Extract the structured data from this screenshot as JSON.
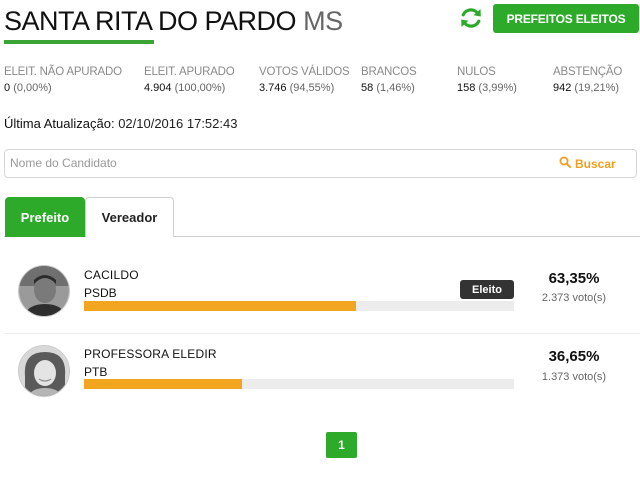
{
  "header": {
    "city": "SANTA RITA DO PARDO",
    "uf": "MS",
    "eleitos_button": "PREFEITOS ELEITOS",
    "refresh_icon": "refresh-icon"
  },
  "stats": [
    {
      "label": "ELEIT. NÃO APURADO",
      "value": "0",
      "pct": "(0,00%)"
    },
    {
      "label": "ELEIT. APURADO",
      "value": "4.904",
      "pct": "(100,00%)"
    },
    {
      "label": "VOTOS VÁLIDOS",
      "value": "3.746",
      "pct": "(94,55%)"
    },
    {
      "label": "BRANCOS",
      "value": "58",
      "pct": "(1,46%)"
    },
    {
      "label": "NULOS",
      "value": "158",
      "pct": "(3,99%)"
    },
    {
      "label": "ABSTENÇÃO",
      "value": "942",
      "pct": "(19,21%)"
    }
  ],
  "update": {
    "label": "Última Atualização:",
    "time": "02/10/2016 17:52:43"
  },
  "search": {
    "placeholder": "Nome do Candidato",
    "button": "Buscar"
  },
  "tabs": [
    {
      "label": "Prefeito",
      "active": true
    },
    {
      "label": "Vereador",
      "active": false
    }
  ],
  "candidates": [
    {
      "name": "CACILDO",
      "party": "PSDB",
      "status": "Eleito",
      "percent": "63,35%",
      "votes": "2.373 voto(s)",
      "bar_fraction": 0.6335
    },
    {
      "name": "PROFESSORA ELEDIR",
      "party": "PTB",
      "status": "",
      "percent": "36,65%",
      "votes": "1.373 voto(s)",
      "bar_fraction": 0.3665
    }
  ],
  "pagination": {
    "current": "1"
  },
  "colors": {
    "green": "#2eaa2a",
    "bar": "#f2a51e",
    "search_accent": "#f0a020"
  }
}
